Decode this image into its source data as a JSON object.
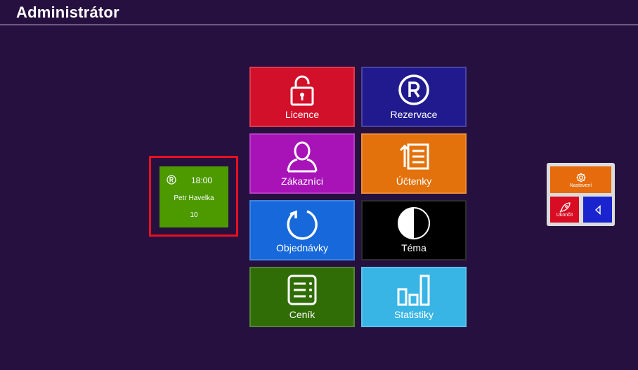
{
  "header": {
    "title": "Administrátor"
  },
  "tiles": [
    {
      "label": "Licence",
      "icon": "lock-icon",
      "color": "#d3102a"
    },
    {
      "label": "Rezervace",
      "icon": "registered-icon",
      "color": "#211a8f"
    },
    {
      "label": "Zákazníci",
      "icon": "user-icon",
      "color": "#a813b8"
    },
    {
      "label": "Účtenky",
      "icon": "receipt-list-icon",
      "color": "#e3720c"
    },
    {
      "label": "Objednávky",
      "icon": "refresh-icon",
      "color": "#1668db"
    },
    {
      "label": "Téma",
      "icon": "contrast-icon",
      "color": "#000000"
    },
    {
      "label": "Ceník",
      "icon": "price-list-icon",
      "color": "#306d06"
    },
    {
      "label": "Statistiky",
      "icon": "bar-chart-icon",
      "color": "#38b4e5"
    }
  ],
  "reservation": {
    "time": "18:00",
    "name": "Petr Havelka",
    "count": "10",
    "color": "#4c9a00",
    "highlight_color": "#e8101f"
  },
  "side_panel": {
    "settings_label": "Nastavení",
    "quit_label": "Ukončit"
  }
}
